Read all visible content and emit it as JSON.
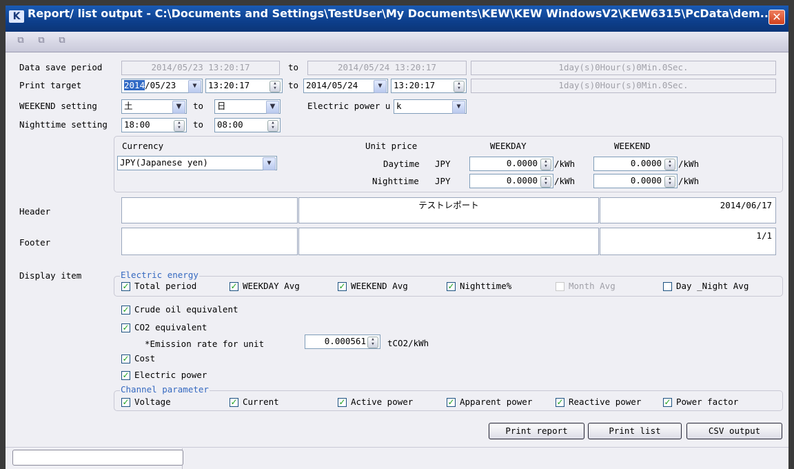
{
  "window": {
    "title": "Report/ list output - C:\\Documents and Settings\\TestUser\\My Documents\\KEW\\KEW WindowsV2\\KEW6315\\PcData\\dem...",
    "app_icon": "K",
    "close_glyph": "✕"
  },
  "toolbar": {
    "icons": [
      "tile-icon",
      "window-icon",
      "cascade-icon"
    ]
  },
  "data_save_period": {
    "label": "Data save period",
    "start": "2014/05/23 13:20:17",
    "to": "to",
    "end": "2014/05/24 13:20:17",
    "duration": "1day(s)0Hour(s)0Min.0Sec."
  },
  "print_target": {
    "label": "Print target",
    "start_year_selected": "2014",
    "start_date_rest": "/05/23",
    "start_time": "13:20:17",
    "to": "to",
    "end_date": "2014/05/24",
    "end_time": "13:20:17",
    "duration": "1day(s)0Hour(s)0Min.0Sec."
  },
  "weekend_setting": {
    "label": "WEEKEND setting",
    "from": "土",
    "to_label": "to",
    "to": "日",
    "power_unit_label": "Electric power u",
    "power_unit_value": "k"
  },
  "nighttime_setting": {
    "label": "Nighttime setting",
    "from": "18:00",
    "to_label": "to",
    "to": "08:00"
  },
  "pricing": {
    "currency_label": "Currency",
    "currency_value": "JPY(Japanese yen)",
    "unit_price_label": "Unit price",
    "weekday_label": "WEEKDAY",
    "weekend_label": "WEEKEND",
    "rows": [
      {
        "label": "Daytime",
        "currency": "JPY",
        "weekday": "0.0000",
        "weekday_unit": "/kWh",
        "weekend": "0.0000",
        "weekend_unit": "/kWh"
      },
      {
        "label": "Nighttime",
        "currency": "JPY",
        "weekday": "0.0000",
        "weekday_unit": "/kWh",
        "weekend": "0.0000",
        "weekend_unit": "/kWh"
      }
    ]
  },
  "header": {
    "label": "Header",
    "left": "",
    "center": "テストレポート",
    "right": "2014/06/17"
  },
  "footer": {
    "label": "Footer",
    "left": "",
    "center": "",
    "right": "1/1"
  },
  "display_item": {
    "label": "Display item",
    "electric_energy_title": "Electric energy",
    "energy_items": [
      {
        "label": "Total period",
        "checked": true,
        "enabled": true
      },
      {
        "label": "WEEKDAY Avg",
        "checked": true,
        "enabled": true
      },
      {
        "label": "WEEKEND Avg",
        "checked": true,
        "enabled": true
      },
      {
        "label": "Nighttime%",
        "checked": true,
        "enabled": true
      },
      {
        "label": "Month Avg",
        "checked": false,
        "enabled": false
      },
      {
        "label": "Day _Night Avg",
        "checked": false,
        "enabled": true
      }
    ],
    "crude_oil": {
      "label": "Crude oil equivalent",
      "checked": true
    },
    "co2": {
      "label": "CO2 equivalent",
      "checked": true,
      "emission_label": "*Emission rate for unit",
      "emission_value": "0.000561",
      "emission_unit": "tCO2/kWh"
    },
    "cost": {
      "label": "Cost",
      "checked": true
    },
    "electric_power": {
      "label": "Electric power",
      "checked": true
    },
    "channel_title": "Channel parameter",
    "channel_items": [
      {
        "label": "Voltage",
        "checked": true
      },
      {
        "label": "Current",
        "checked": true
      },
      {
        "label": "Active power",
        "checked": true
      },
      {
        "label": "Apparent power",
        "checked": true
      },
      {
        "label": "Reactive power",
        "checked": true
      },
      {
        "label": "Power factor",
        "checked": true
      }
    ]
  },
  "buttons": {
    "print_report": "Print report",
    "print_list": "Print list",
    "csv_output": "CSV output"
  },
  "status_bar": {
    "progress": 0
  },
  "colors": {
    "title_bar": "#0d3f8c",
    "window_bg": "#efeff4",
    "group_title": "#3569c0",
    "check": "#21a121"
  }
}
